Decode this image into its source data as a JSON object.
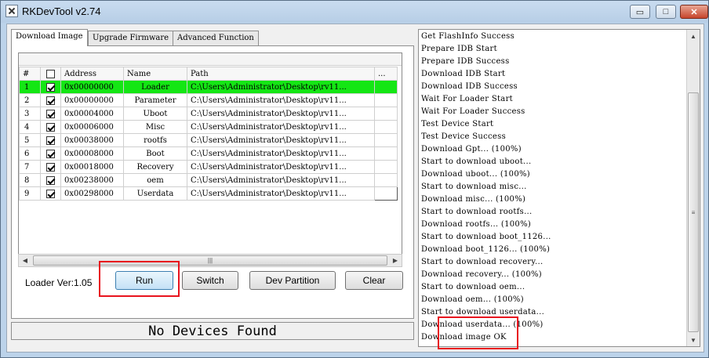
{
  "window": {
    "title": "RKDevTool v2.74",
    "min_glyph": "▭",
    "max_glyph": "□",
    "close_glyph": "✕"
  },
  "tabs": [
    {
      "label": "Download Image",
      "active": true
    },
    {
      "label": "Upgrade Firmware",
      "active": false
    },
    {
      "label": "Advanced Function",
      "active": false
    }
  ],
  "table": {
    "columns": [
      "#",
      "",
      "Address",
      "Name",
      "Path",
      "..."
    ],
    "rows": [
      {
        "num": "1",
        "checked": true,
        "address": "0x00000000",
        "name": "Loader",
        "path": "C:\\Users\\Administrator\\Desktop\\rv11...",
        "highlight": true
      },
      {
        "num": "2",
        "checked": true,
        "address": "0x00000000",
        "name": "Parameter",
        "path": "C:\\Users\\Administrator\\Desktop\\rv11..."
      },
      {
        "num": "3",
        "checked": true,
        "address": "0x00004000",
        "name": "Uboot",
        "path": "C:\\Users\\Administrator\\Desktop\\rv11..."
      },
      {
        "num": "4",
        "checked": true,
        "address": "0x00006000",
        "name": "Misc",
        "path": "C:\\Users\\Administrator\\Desktop\\rv11..."
      },
      {
        "num": "5",
        "checked": true,
        "address": "0x00038000",
        "name": "rootfs",
        "path": "C:\\Users\\Administrator\\Desktop\\rv11..."
      },
      {
        "num": "6",
        "checked": true,
        "address": "0x00008000",
        "name": "Boot",
        "path": "C:\\Users\\Administrator\\Desktop\\rv11..."
      },
      {
        "num": "7",
        "checked": true,
        "address": "0x00018000",
        "name": "Recovery",
        "path": "C:\\Users\\Administrator\\Desktop\\rv11..."
      },
      {
        "num": "8",
        "checked": true,
        "address": "0x00238000",
        "name": "oem",
        "path": "C:\\Users\\Administrator\\Desktop\\rv11..."
      },
      {
        "num": "9",
        "checked": true,
        "address": "0x00298000",
        "name": "Userdata",
        "path": "C:\\Users\\Administrator\\Desktop\\rv11..."
      }
    ]
  },
  "scrollbar": {
    "left": "◀",
    "right": "▶",
    "up": "▲",
    "down": "▼",
    "grip_h": "|||",
    "grip_v": "≡"
  },
  "loader_ver": "Loader Ver:1.05",
  "buttons": {
    "run": "Run",
    "switch": "Switch",
    "dev_partition": "Dev Partition",
    "clear": "Clear"
  },
  "status": "No Devices Found",
  "log": [
    "Get FlashInfo Success",
    "Prepare IDB Start",
    "Prepare IDB Success",
    "Download IDB Start",
    "Download IDB Success",
    "Wait For Loader Start",
    "Wait For Loader Success",
    "Test Device Start",
    "Test Device Success",
    "Download Gpt... (100%)",
    "Start to download uboot...",
    "Download uboot... (100%)",
    "Start to download misc...",
    "Download misc... (100%)",
    "Start to download rootfs...",
    "Download rootfs... (100%)",
    "Start to download boot_1126...",
    "Download boot_1126... (100%)",
    "Start to download recovery...",
    "Download recovery... (100%)",
    "Start to download oem...",
    "Download oem... (100%)",
    "Start to download userdata...",
    "Download userdata... (100%)",
    "Download image OK"
  ],
  "colors": {
    "highlight_row": "#14e614",
    "annotation_box": "#e8131e"
  }
}
